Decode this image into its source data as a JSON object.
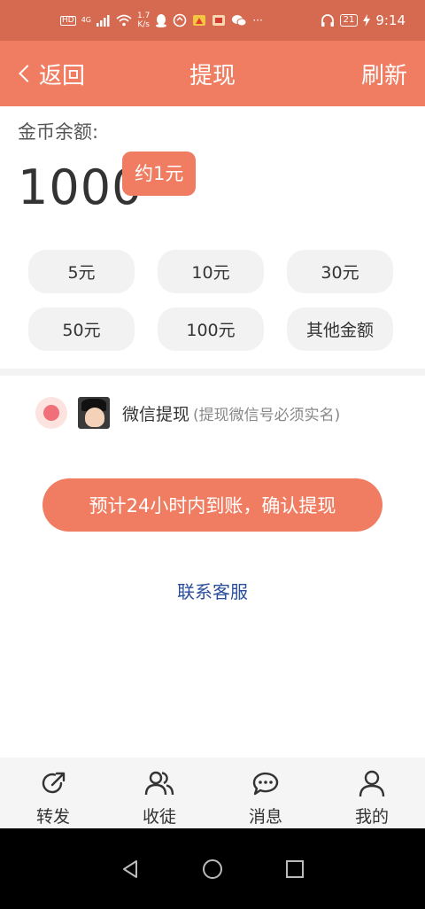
{
  "status_bar": {
    "hd": "HD",
    "network": "4G",
    "speed": "1.7\nK/s",
    "battery": "21",
    "time": "9:14"
  },
  "app_bar": {
    "back_label": "返回",
    "title": "提现",
    "refresh_label": "刷新"
  },
  "balance": {
    "label": "金币余额:",
    "value": "1000",
    "approx": "约1元"
  },
  "amounts": [
    "5元",
    "10元",
    "30元",
    "50元",
    "100元",
    "其他金额"
  ],
  "payment": {
    "method": "微信提现",
    "note": "(提现微信号必须实名)",
    "selected": true
  },
  "confirm_label": "预计24小时内到账，确认提现",
  "contact_label": "联系客服",
  "tabs": [
    {
      "label": "转发",
      "icon": "share-icon"
    },
    {
      "label": "收徒",
      "icon": "users-icon"
    },
    {
      "label": "消息",
      "icon": "message-icon"
    },
    {
      "label": "我的",
      "icon": "user-icon"
    }
  ],
  "colors": {
    "status_bar": "#d56a51",
    "accent": "#f07d62",
    "radio": "#f06f78",
    "link": "#2a4f9a"
  }
}
